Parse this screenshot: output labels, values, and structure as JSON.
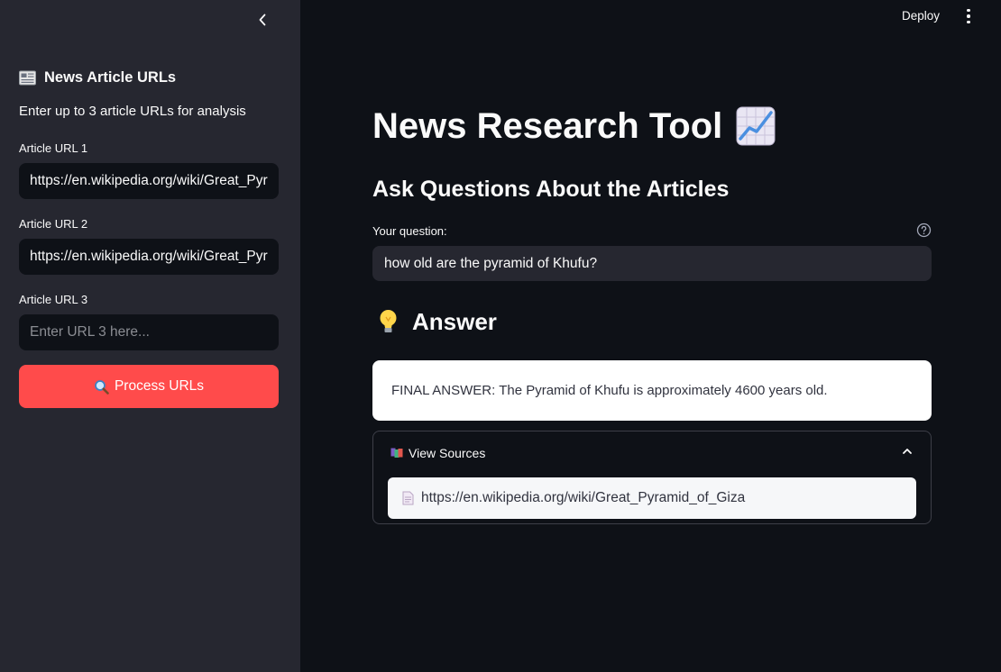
{
  "sidebar": {
    "title": "News Article URLs",
    "subtitle": "Enter up to 3 article URLs for analysis",
    "fields": [
      {
        "label": "Article URL 1",
        "value": "https://en.wikipedia.org/wiki/Great_Pyr",
        "placeholder": ""
      },
      {
        "label": "Article URL 2",
        "value": "https://en.wikipedia.org/wiki/Great_Pyr",
        "placeholder": ""
      },
      {
        "label": "Article URL 3",
        "value": "",
        "placeholder": "Enter URL 3 here..."
      }
    ],
    "process_button": {
      "label": "Process URLs",
      "icon": "magnifier-icon"
    }
  },
  "topbar": {
    "deploy_label": "Deploy",
    "menu_icon": "kebab-menu-icon"
  },
  "main": {
    "title": "News Research Tool",
    "title_icon": "chart-increasing-icon",
    "section_heading": "Ask Questions About the Articles",
    "question": {
      "label": "Your question:",
      "value": "how old are the pyramid of Khufu?",
      "help_icon": "help-circle-icon"
    },
    "answer": {
      "heading": "Answer",
      "heading_icon": "light-bulb-icon",
      "text": "FINAL ANSWER: The Pyramid of Khufu is approximately 4600 years old."
    },
    "sources": {
      "label": "View Sources",
      "icon": "books-icon",
      "expanded": true,
      "items": [
        "https://en.wikipedia.org/wiki/Great_Pyramid_of_Giza"
      ]
    }
  },
  "colors": {
    "sidebar_bg": "#262730",
    "main_bg": "#0e1117",
    "accent": "#ff4b4b",
    "input_bg_sidebar": "#0e1117",
    "input_bg_main": "#262730",
    "answer_bg": "#ffffff"
  }
}
